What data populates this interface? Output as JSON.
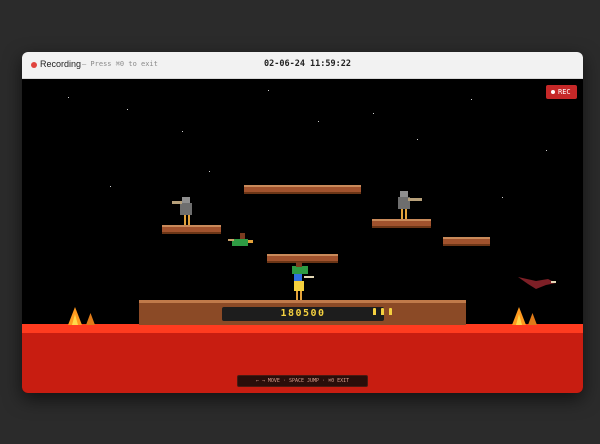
{
  "titlebar": {
    "recording_label": "Recording",
    "exit_hint": "— Press ⌘0 to exit",
    "timestamp": "02-06-24 11:59:22"
  },
  "game": {
    "rec_badge": "REC",
    "score": "180500",
    "lives": 3,
    "controls_hint": "← → MOVE · SPACE JUMP · ⌘0 EXIT"
  },
  "colors": {
    "lava": "#c81d11",
    "lava_surface": "#ff3b1f",
    "platform": "#a0522d",
    "score": "#f4d03f",
    "rec_badge": "#c62828"
  }
}
